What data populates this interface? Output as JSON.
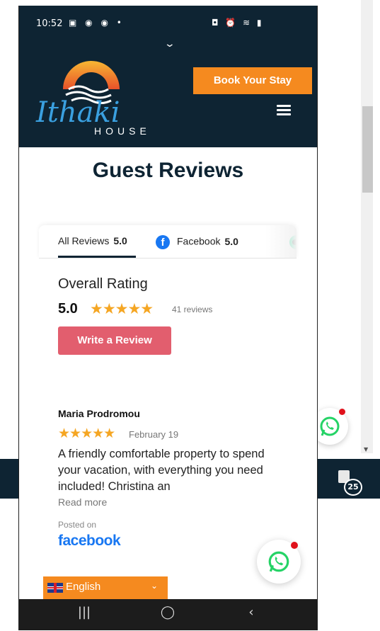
{
  "status_bar": {
    "time": "10:52",
    "left_icons": "▣ ◉ ◉ •",
    "right_icons": "◘ ⏰ ≋ ▮"
  },
  "header": {
    "chevron": "⌄",
    "logo_text_main": "Ithaki",
    "logo_text_sub": "HOUSE",
    "book_button": "Book Your Stay",
    "menu_icon": "hamburger-menu-icon"
  },
  "page": {
    "title": "Guest Reviews"
  },
  "tabs": [
    {
      "label": "All Reviews",
      "score": "5.0",
      "active": true
    },
    {
      "label": "Facebook",
      "score": "5.0",
      "icon": "facebook-icon"
    },
    {
      "label": "",
      "icon": "tripadvisor-icon"
    }
  ],
  "overall": {
    "label": "Overall Rating",
    "score": "5.0",
    "stars": "★★★★★",
    "count": "41 reviews",
    "write_button": "Write a Review"
  },
  "review": {
    "author": "Maria Prodromou",
    "stars": "★★★★★",
    "date": "February 19",
    "text": "A friendly comfortable property to spend your vacation, with everything you need included! Christina an",
    "read_more": "Read more",
    "posted_on": "Posted on",
    "source": "facebook"
  },
  "language": {
    "label": "English",
    "caret": "⌄"
  },
  "background": {
    "notification_count": "25"
  },
  "nav": {
    "recent": "|||",
    "home": "◯",
    "back": "‹"
  },
  "colors": {
    "navy": "#0e2433",
    "orange": "#f58a1f",
    "coral": "#e25e6e",
    "star": "#f5a623",
    "facebook_blue": "#1877f2"
  }
}
